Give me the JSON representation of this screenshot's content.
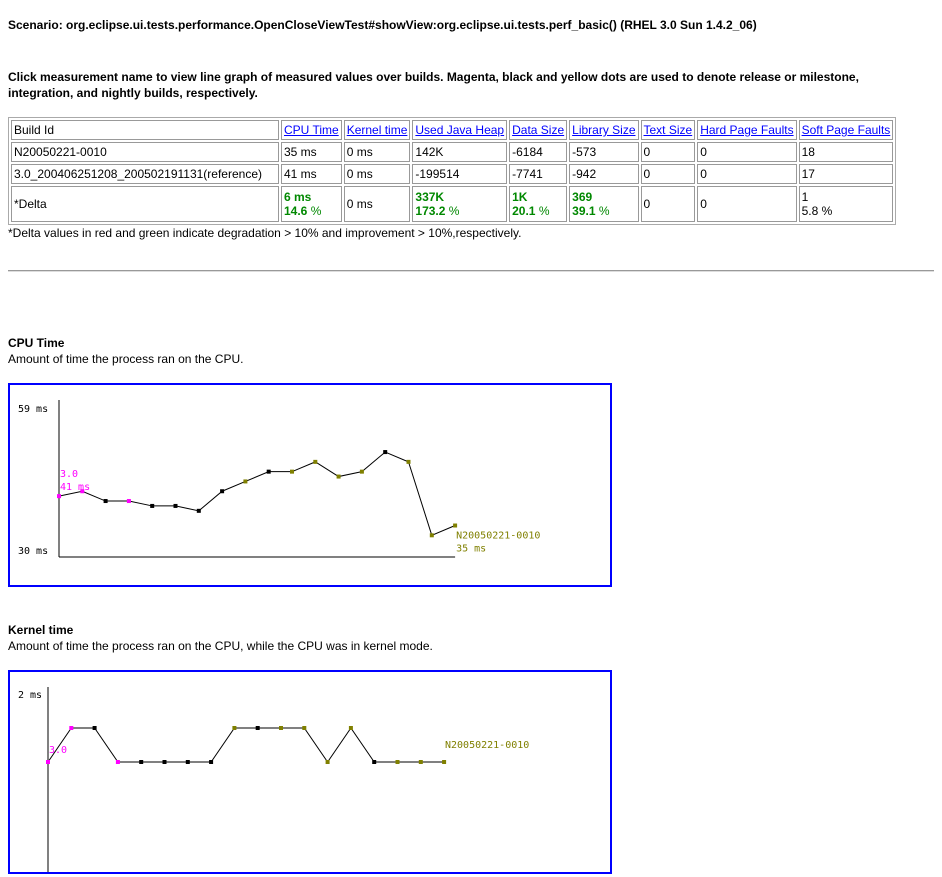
{
  "scenario": "Scenario: org.eclipse.ui.tests.performance.OpenCloseViewTest#showView:org.eclipse.ui.tests.perf_basic() (RHEL 3.0 Sun 1.4.2_06)",
  "intro": "Click measurement name to view line graph of measured values over builds. Magenta, black and yellow dots are used to denote release or milestone, integration, and nightly builds, respectively.",
  "table": {
    "headers": [
      "Build Id",
      "CPU Time",
      "Kernel time",
      "Used Java Heap",
      "Data Size",
      "Library Size",
      "Text Size",
      "Hard Page Faults",
      "Soft Page Faults"
    ],
    "rows": [
      [
        "N20050221-0010",
        "35 ms",
        "0 ms",
        "142K",
        "-6184",
        "-573",
        "0",
        "0",
        "18"
      ],
      [
        "3.0_200406251208_200502191131(reference)",
        "41 ms",
        "0 ms",
        "-199514",
        "-7741",
        "-942",
        "0",
        "0",
        "17"
      ]
    ],
    "delta": {
      "label": "*Delta",
      "cells": [
        [
          "6 ms",
          "14.6"
        ],
        [
          "0 ms",
          ""
        ],
        [
          "337K",
          "173.2"
        ],
        [
          "1K",
          "20.1"
        ],
        [
          "369",
          "39.1"
        ],
        [
          "0",
          ""
        ],
        [
          "0",
          ""
        ],
        [
          "1",
          "5.8 %"
        ]
      ]
    }
  },
  "note": "*Delta values in red and green indicate degradation > 10% and improvement > 10%,respectively.",
  "pct": "%",
  "colors": {
    "release": "#ff00ff",
    "integration": "#000000",
    "nightly": "#808000",
    "border": "#0000ff"
  },
  "chart_data": [
    {
      "type": "line",
      "title": "CPU Time",
      "description": "Amount of time the process ran on the CPU.",
      "ymax_label": "59 ms",
      "ymin_label": "30 ms",
      "ylim": [
        30,
        59
      ],
      "values": [
        41,
        42,
        40,
        40,
        39,
        39,
        38,
        42,
        44,
        46,
        46,
        48,
        45,
        46,
        50,
        48,
        33,
        35
      ],
      "kinds": [
        "release",
        "release",
        "integration",
        "release",
        "integration",
        "integration",
        "integration",
        "integration",
        "nightly",
        "integration",
        "nightly",
        "nightly",
        "nightly",
        "nightly",
        "integration",
        "nightly",
        "nightly",
        "nightly"
      ],
      "first_label": [
        "3.0",
        "41 ms"
      ],
      "last_label": [
        "N20050221-0010",
        "35 ms"
      ]
    },
    {
      "type": "line",
      "title": "Kernel time",
      "description": "Amount of time the process ran on the CPU, while the CPU was in kernel mode.",
      "ymax_label": "2 ms",
      "ylim": [
        0,
        2
      ],
      "values": [
        0,
        1,
        1,
        0,
        0,
        0,
        0,
        0,
        1,
        1,
        1,
        1,
        0,
        1,
        0,
        0,
        0,
        0
      ],
      "kinds": [
        "release",
        "release",
        "integration",
        "release",
        "integration",
        "integration",
        "integration",
        "integration",
        "nightly",
        "integration",
        "nightly",
        "nightly",
        "nightly",
        "nightly",
        "integration",
        "nightly",
        "nightly",
        "nightly"
      ],
      "first_label": [
        "3.0"
      ],
      "last_label": [
        "N20050221-0010"
      ]
    }
  ]
}
